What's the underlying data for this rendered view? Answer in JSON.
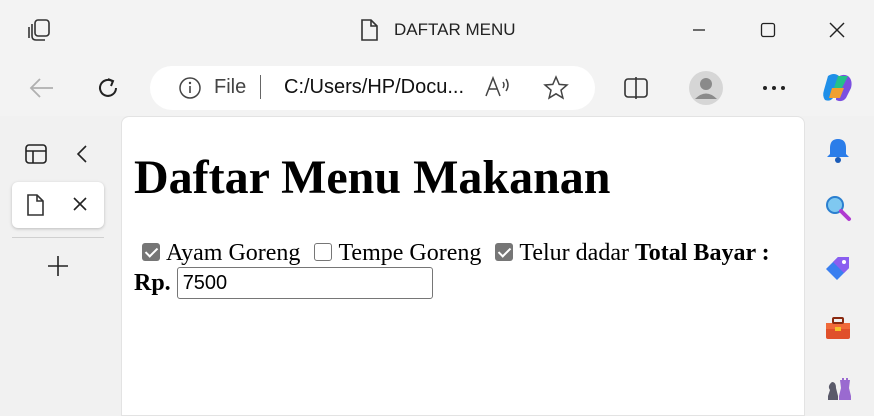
{
  "window": {
    "title": "DAFTAR MENU"
  },
  "address": {
    "scheme_label": "File",
    "url": "C:/Users/HP/Docu..."
  },
  "page": {
    "heading": "Daftar Menu Makanan",
    "items": [
      {
        "label": "Ayam Goreng",
        "checked": true
      },
      {
        "label": "Tempe Goreng",
        "checked": false
      },
      {
        "label": "Telur dadar",
        "checked": true
      }
    ],
    "total_label": "Total Bayar :",
    "currency_label": "Rp.",
    "total_value": "7500"
  },
  "colors": {
    "chrome_bg": "#f3f3f3",
    "content_bg": "#ffffff",
    "checkbox_checked": "#767676"
  },
  "icons": {
    "app": "tab-actions-icon",
    "page": "document-icon",
    "back": "back-arrow-icon",
    "refresh": "refresh-icon",
    "info": "info-icon",
    "read_aloud": "read-aloud-icon",
    "favorite": "star-icon",
    "split": "split-screen-icon",
    "profile": "profile-icon",
    "more": "more-icon",
    "copilot": "copilot-icon",
    "bell": "bell-icon",
    "search": "search-icon",
    "tag": "tag-icon",
    "toolbox": "toolbox-icon",
    "chess": "chess-icon"
  }
}
